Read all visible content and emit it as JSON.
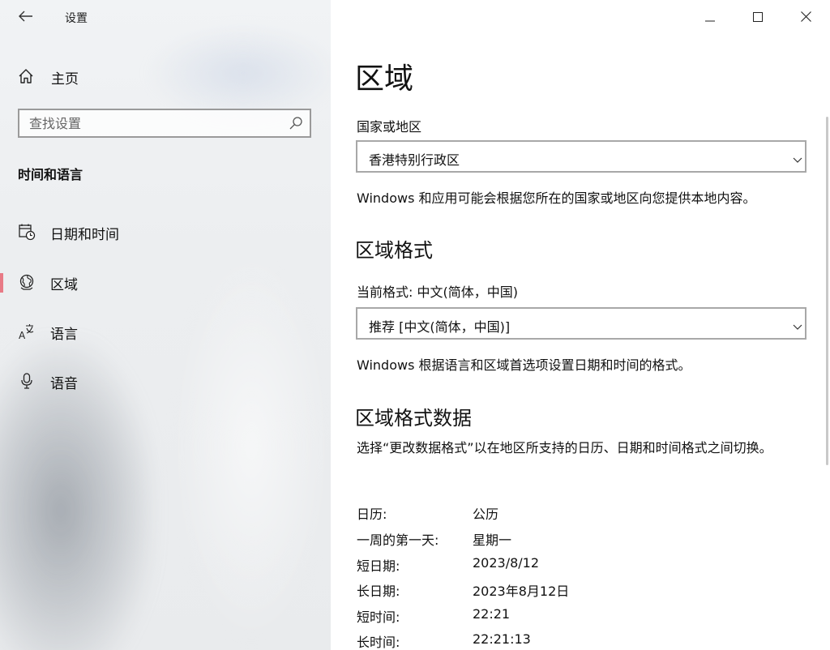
{
  "window": {
    "title": "设置"
  },
  "sidebar": {
    "home_label": "主页",
    "search_placeholder": "查找设置",
    "section_title": "时间和语言",
    "items": [
      {
        "label": "日期和时间",
        "icon": "calendar-clock-icon",
        "selected": false
      },
      {
        "label": "区域",
        "icon": "globe-region-icon",
        "selected": true
      },
      {
        "label": "语言",
        "icon": "language-icon",
        "selected": false
      },
      {
        "label": "语音",
        "icon": "microphone-icon",
        "selected": false
      }
    ],
    "accent_color": "#e87a86"
  },
  "main": {
    "title": "区域",
    "country_label": "国家或地区",
    "country_value": "香港特别行政区",
    "country_desc": "Windows 和应用可能会根据您所在的国家或地区向您提供本地内容。",
    "format_heading": "区域格式",
    "current_format_label": "当前格式: 中文(简体，中国)",
    "format_value": "推荐 [中文(简体，中国)]",
    "format_desc": "Windows 根据语言和区域首选项设置日期和时间的格式。",
    "format_data_heading": "区域格式数据",
    "format_data_desc": "选择“更改数据格式”以在地区所支持的日历、日期和时间格式之间切换。",
    "format_data": [
      {
        "key": "日历:",
        "value": "公历"
      },
      {
        "key": "一周的第一天:",
        "value": "星期一"
      },
      {
        "key": "短日期:",
        "value": "2023/8/12"
      },
      {
        "key": "长日期:",
        "value": "2023年8月12日"
      },
      {
        "key": "短时间:",
        "value": "22:21"
      },
      {
        "key": "长时间:",
        "value": "22:21:13"
      }
    ]
  }
}
